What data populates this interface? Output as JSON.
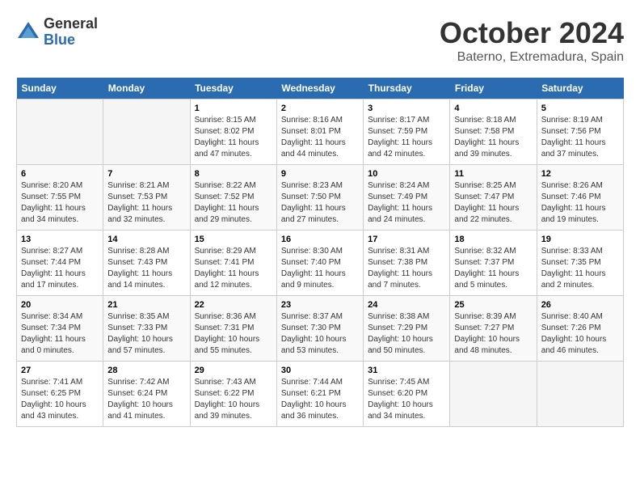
{
  "header": {
    "logo_general": "General",
    "logo_blue": "Blue",
    "month_title": "October 2024",
    "subtitle": "Baterno, Extremadura, Spain"
  },
  "days_of_week": [
    "Sunday",
    "Monday",
    "Tuesday",
    "Wednesday",
    "Thursday",
    "Friday",
    "Saturday"
  ],
  "weeks": [
    [
      {
        "day": "",
        "info": ""
      },
      {
        "day": "",
        "info": ""
      },
      {
        "day": "1",
        "info": "Sunrise: 8:15 AM\nSunset: 8:02 PM\nDaylight: 11 hours and 47 minutes."
      },
      {
        "day": "2",
        "info": "Sunrise: 8:16 AM\nSunset: 8:01 PM\nDaylight: 11 hours and 44 minutes."
      },
      {
        "day": "3",
        "info": "Sunrise: 8:17 AM\nSunset: 7:59 PM\nDaylight: 11 hours and 42 minutes."
      },
      {
        "day": "4",
        "info": "Sunrise: 8:18 AM\nSunset: 7:58 PM\nDaylight: 11 hours and 39 minutes."
      },
      {
        "day": "5",
        "info": "Sunrise: 8:19 AM\nSunset: 7:56 PM\nDaylight: 11 hours and 37 minutes."
      }
    ],
    [
      {
        "day": "6",
        "info": "Sunrise: 8:20 AM\nSunset: 7:55 PM\nDaylight: 11 hours and 34 minutes."
      },
      {
        "day": "7",
        "info": "Sunrise: 8:21 AM\nSunset: 7:53 PM\nDaylight: 11 hours and 32 minutes."
      },
      {
        "day": "8",
        "info": "Sunrise: 8:22 AM\nSunset: 7:52 PM\nDaylight: 11 hours and 29 minutes."
      },
      {
        "day": "9",
        "info": "Sunrise: 8:23 AM\nSunset: 7:50 PM\nDaylight: 11 hours and 27 minutes."
      },
      {
        "day": "10",
        "info": "Sunrise: 8:24 AM\nSunset: 7:49 PM\nDaylight: 11 hours and 24 minutes."
      },
      {
        "day": "11",
        "info": "Sunrise: 8:25 AM\nSunset: 7:47 PM\nDaylight: 11 hours and 22 minutes."
      },
      {
        "day": "12",
        "info": "Sunrise: 8:26 AM\nSunset: 7:46 PM\nDaylight: 11 hours and 19 minutes."
      }
    ],
    [
      {
        "day": "13",
        "info": "Sunrise: 8:27 AM\nSunset: 7:44 PM\nDaylight: 11 hours and 17 minutes."
      },
      {
        "day": "14",
        "info": "Sunrise: 8:28 AM\nSunset: 7:43 PM\nDaylight: 11 hours and 14 minutes."
      },
      {
        "day": "15",
        "info": "Sunrise: 8:29 AM\nSunset: 7:41 PM\nDaylight: 11 hours and 12 minutes."
      },
      {
        "day": "16",
        "info": "Sunrise: 8:30 AM\nSunset: 7:40 PM\nDaylight: 11 hours and 9 minutes."
      },
      {
        "day": "17",
        "info": "Sunrise: 8:31 AM\nSunset: 7:38 PM\nDaylight: 11 hours and 7 minutes."
      },
      {
        "day": "18",
        "info": "Sunrise: 8:32 AM\nSunset: 7:37 PM\nDaylight: 11 hours and 5 minutes."
      },
      {
        "day": "19",
        "info": "Sunrise: 8:33 AM\nSunset: 7:35 PM\nDaylight: 11 hours and 2 minutes."
      }
    ],
    [
      {
        "day": "20",
        "info": "Sunrise: 8:34 AM\nSunset: 7:34 PM\nDaylight: 11 hours and 0 minutes."
      },
      {
        "day": "21",
        "info": "Sunrise: 8:35 AM\nSunset: 7:33 PM\nDaylight: 10 hours and 57 minutes."
      },
      {
        "day": "22",
        "info": "Sunrise: 8:36 AM\nSunset: 7:31 PM\nDaylight: 10 hours and 55 minutes."
      },
      {
        "day": "23",
        "info": "Sunrise: 8:37 AM\nSunset: 7:30 PM\nDaylight: 10 hours and 53 minutes."
      },
      {
        "day": "24",
        "info": "Sunrise: 8:38 AM\nSunset: 7:29 PM\nDaylight: 10 hours and 50 minutes."
      },
      {
        "day": "25",
        "info": "Sunrise: 8:39 AM\nSunset: 7:27 PM\nDaylight: 10 hours and 48 minutes."
      },
      {
        "day": "26",
        "info": "Sunrise: 8:40 AM\nSunset: 7:26 PM\nDaylight: 10 hours and 46 minutes."
      }
    ],
    [
      {
        "day": "27",
        "info": "Sunrise: 7:41 AM\nSunset: 6:25 PM\nDaylight: 10 hours and 43 minutes."
      },
      {
        "day": "28",
        "info": "Sunrise: 7:42 AM\nSunset: 6:24 PM\nDaylight: 10 hours and 41 minutes."
      },
      {
        "day": "29",
        "info": "Sunrise: 7:43 AM\nSunset: 6:22 PM\nDaylight: 10 hours and 39 minutes."
      },
      {
        "day": "30",
        "info": "Sunrise: 7:44 AM\nSunset: 6:21 PM\nDaylight: 10 hours and 36 minutes."
      },
      {
        "day": "31",
        "info": "Sunrise: 7:45 AM\nSunset: 6:20 PM\nDaylight: 10 hours and 34 minutes."
      },
      {
        "day": "",
        "info": ""
      },
      {
        "day": "",
        "info": ""
      }
    ]
  ]
}
